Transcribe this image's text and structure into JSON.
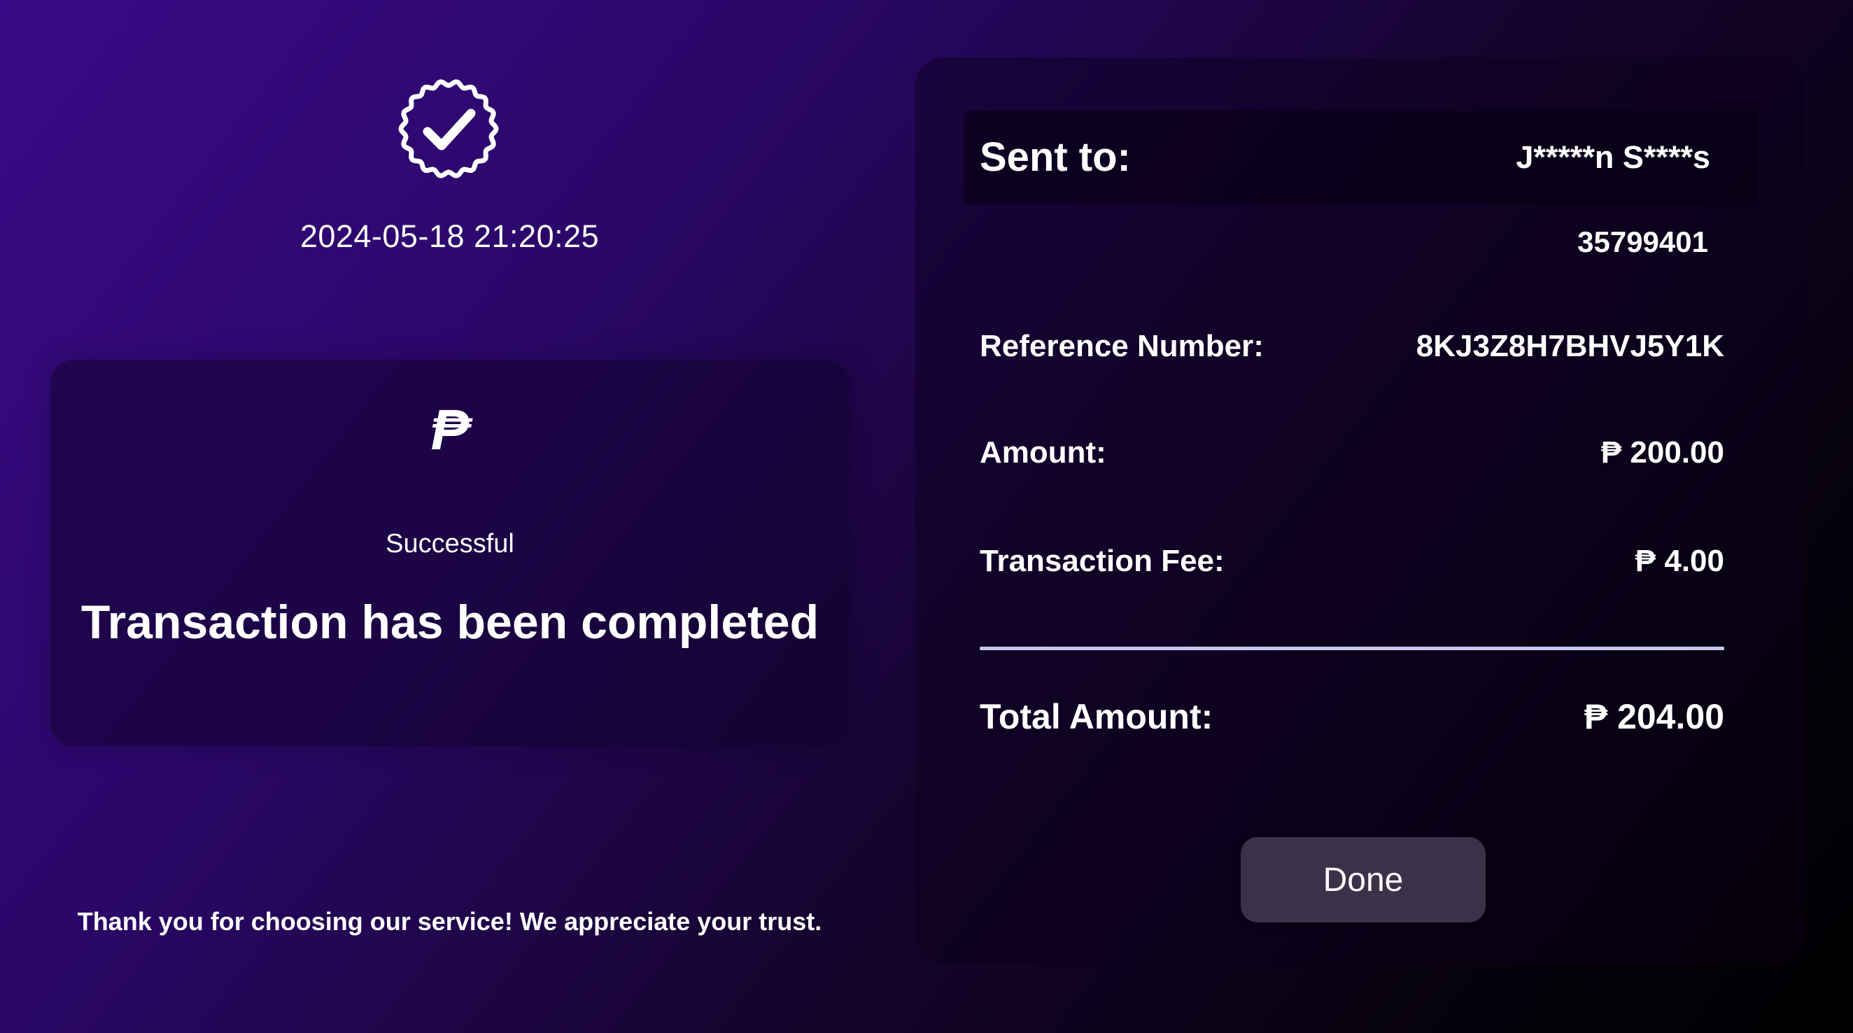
{
  "receipt": {
    "timestamp": "2024-05-18 21:20:25",
    "badge_icon": "verified-check-badge-icon",
    "peso_symbol": "₱",
    "status_label": "Successful",
    "status_message": "Transaction has been completed",
    "thank_you": "Thank you for choosing our service! We appreciate your trust."
  },
  "details": {
    "sent_to_label": "Sent to:",
    "recipient_name": "J*****n S****s",
    "account_number": "35799401",
    "reference_label": "Reference Number:",
    "reference_value": "8KJ3Z8H7BHVJ5Y1K",
    "amount_label": "Amount:",
    "amount_value": "₱ 200.00",
    "fee_label": "Transaction Fee:",
    "fee_value": "₱ 4.00",
    "total_label": "Total Amount:",
    "total_value": "₱ 204.00"
  },
  "actions": {
    "done_label": "Done"
  },
  "colors": {
    "gradient_start": "#3a0a86",
    "gradient_end": "#000000",
    "divider": "#c9c6ef",
    "button_bg": "#3b3148"
  }
}
